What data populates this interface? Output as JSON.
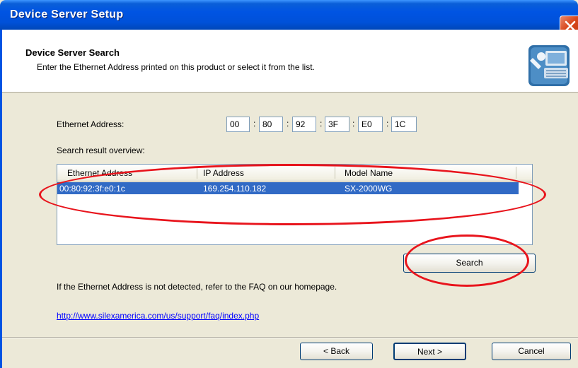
{
  "window": {
    "title": "Device Server Setup"
  },
  "header": {
    "heading": "Device Server Search",
    "subheading": "Enter the Ethernet Address printed on this product or select it from the list."
  },
  "ethernet": {
    "label": "Ethernet Address:",
    "octets": [
      "00",
      "80",
      "92",
      "3F",
      "E0",
      "1C"
    ],
    "separator": ":"
  },
  "results": {
    "label": "Search result overview:",
    "columns": [
      "Ethernet Address",
      "IP Address",
      "Model Name"
    ],
    "rows": [
      {
        "ethernet": "00:80:92:3f:e0:1c",
        "ip": "169.254.110.182",
        "model": "SX-2000WG"
      }
    ]
  },
  "search_button": "Search",
  "info_text": "If the Ethernet Address is not detected, refer to the FAQ on our homepage.",
  "faq_link": "http://www.silexamerica.com/us/support/faq/index.php",
  "footer": {
    "back": "< Back",
    "next": "Next >",
    "cancel": "Cancel"
  },
  "colors": {
    "titlebar": "#0054e3",
    "selection": "#316ac5",
    "annotation": "#e8141c",
    "link": "#0000ff"
  }
}
